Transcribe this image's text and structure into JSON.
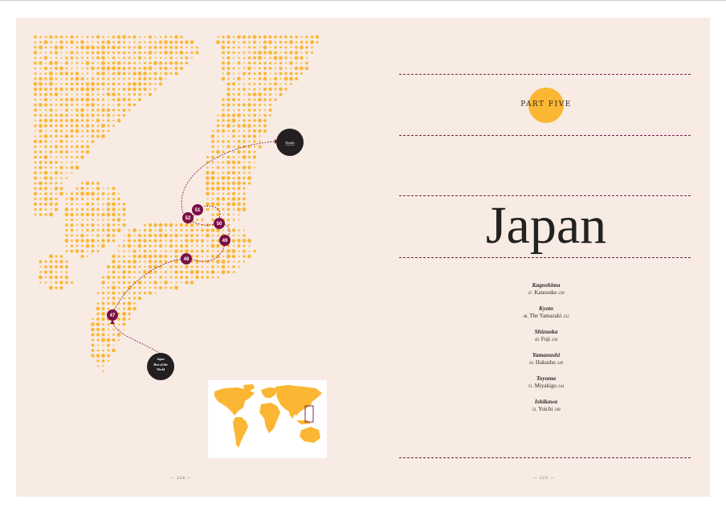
{
  "left_page": {
    "page_number": "— 224 —",
    "markers": [
      "47",
      "48",
      "49",
      "50",
      "51",
      "52"
    ],
    "end_label": "Details",
    "start_label_lines": [
      "Rest of the",
      "World"
    ],
    "start_label_top": "Japan"
  },
  "right_page": {
    "part_label": "PART FIVE",
    "title": "Japan",
    "page_number": "— 225 —",
    "toc": [
      {
        "region": "Kagoshima",
        "num": "47.",
        "name": "Kanosuke",
        "page": "228"
      },
      {
        "region": "Kyoto",
        "num": "48.",
        "name": "The Yamazaki",
        "page": "232"
      },
      {
        "region": "Shizuoka",
        "num": "49.",
        "name": "Fuji",
        "page": "236"
      },
      {
        "region": "Yamanashi",
        "num": "50.",
        "name": "Hakushu",
        "page": "240"
      },
      {
        "region": "Toyama",
        "num": "51.",
        "name": "Miyakigo",
        "page": "244"
      },
      {
        "region": "Ishikawa",
        "num": "52.",
        "name": "Yoichi",
        "page": "248"
      }
    ]
  },
  "colors": {
    "background": "#f7ebe3",
    "dots": "#fbb634",
    "marker": "#7a0f45",
    "dark_circle": "#231f20",
    "rule": "#7a1f4a"
  }
}
